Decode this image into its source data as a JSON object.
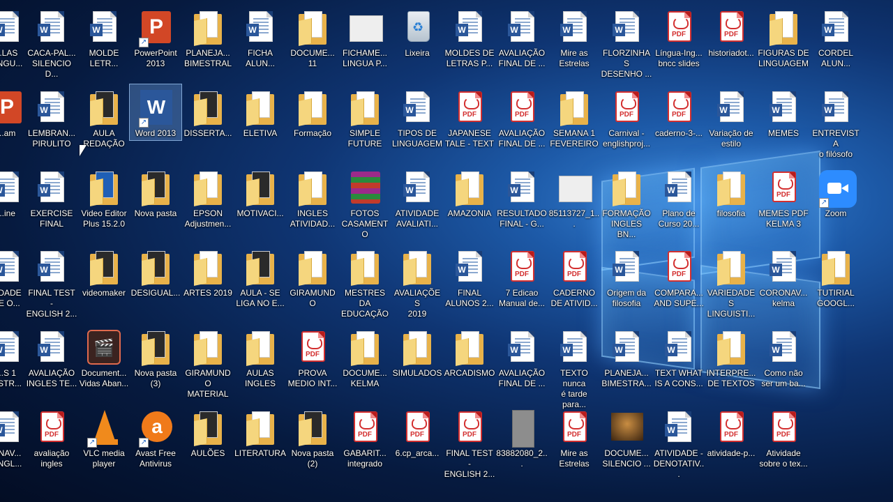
{
  "desktop": {
    "rows": [
      [
        {
          "label": "...LAS\nLINGU...",
          "type": "word"
        },
        {
          "label": "CACA-PAL...\nSILENCIO D...",
          "type": "word"
        },
        {
          "label": "MOLDE\nLETR...",
          "type": "word"
        },
        {
          "label": "PowerPoint\n2013",
          "type": "ppt"
        },
        {
          "label": "PLANEJA...\nBIMESTRAL",
          "type": "folder"
        },
        {
          "label": "FICHA\nALUN...",
          "type": "word"
        },
        {
          "label": "DOCUME...\n11",
          "type": "folder"
        },
        {
          "label": "FICHAME...\nLINGUA P...",
          "type": "thumb"
        },
        {
          "label": "Lixeira",
          "type": "recycle"
        },
        {
          "label": "MOLDES DE\nLETRAS P...",
          "type": "word"
        },
        {
          "label": "AVALIAÇÃO\nFINAL DE ...",
          "type": "word"
        },
        {
          "label": "Mire as\nEstrelas",
          "type": "word"
        },
        {
          "label": "FLORZINHAS\nDESENHO ...",
          "type": "word"
        },
        {
          "label": "Língua-Ing...\nbncc slides",
          "type": "pdf"
        },
        {
          "label": "historiadot...",
          "type": "pdf"
        },
        {
          "label": "FIGURAS DE\nLINGUAGEM",
          "type": "folder"
        },
        {
          "label": "CORDEL\nALUN...",
          "type": "word"
        }
      ],
      [
        {
          "label": "...am",
          "type": "ppt"
        },
        {
          "label": "LEMBRAN...\nPIRULITO",
          "type": "word"
        },
        {
          "label": "AULA\nREDAÇÃO",
          "type": "folder-dark"
        },
        {
          "label": "Word 2013",
          "type": "word2013",
          "selected": true
        },
        {
          "label": "DISSERTA...",
          "type": "folder-dark"
        },
        {
          "label": "ELETIVA",
          "type": "folder"
        },
        {
          "label": "Formação",
          "type": "folder"
        },
        {
          "label": "SIMPLE\nFUTURE",
          "type": "folder"
        },
        {
          "label": "TIPOS DE\nLINGUAGEM",
          "type": "word"
        },
        {
          "label": "JAPANESE\nTALE - TEXT",
          "type": "pdf"
        },
        {
          "label": "AVALIAÇÃO\nFINAL DE ...",
          "type": "pdf"
        },
        {
          "label": "SEMANA 1\nFEVEREIRO",
          "type": "folder"
        },
        {
          "label": "Carnival -\nenglishproj...",
          "type": "pdf"
        },
        {
          "label": "caderno-3-...",
          "type": "pdf"
        },
        {
          "label": "Variação de\nestilo",
          "type": "word"
        },
        {
          "label": "MEMES",
          "type": "word"
        },
        {
          "label": "ENTREVISTA\no filósofo",
          "type": "word"
        }
      ],
      [
        {
          "label": "...ine",
          "type": "word"
        },
        {
          "label": "EXERCISE\nFINAL",
          "type": "word"
        },
        {
          "label": "Video Editor\nPlus 15.2.0",
          "type": "folder-blue"
        },
        {
          "label": "Nova pasta",
          "type": "folder-dark"
        },
        {
          "label": "EPSON\nAdjustmen...",
          "type": "folder"
        },
        {
          "label": "MOTIVACI...",
          "type": "folder-dark"
        },
        {
          "label": "INGLES\nATIVIDAD...",
          "type": "folder"
        },
        {
          "label": "FOTOS\nCASAMENTO",
          "type": "winrar"
        },
        {
          "label": "ATIVIDADE\nAVALIATI...",
          "type": "word"
        },
        {
          "label": "AMAZONIA",
          "type": "folder"
        },
        {
          "label": "RESULTADO\nFINAL - G...",
          "type": "word"
        },
        {
          "label": "85113727_1...",
          "type": "thumb"
        },
        {
          "label": "FORMAÇÃO\nINGLES BN...",
          "type": "folder"
        },
        {
          "label": "Plano de\nCurso 20...",
          "type": "word"
        },
        {
          "label": "filosofia",
          "type": "folder"
        },
        {
          "label": "MEMES PDF\nKELMA 3",
          "type": "pdf"
        },
        {
          "label": "Zoom",
          "type": "zoom"
        }
      ],
      [
        {
          "label": "...DADE\nDE O...",
          "type": "word"
        },
        {
          "label": "FINAL TEST -\nENGLISH 2...",
          "type": "word"
        },
        {
          "label": "videomaker",
          "type": "folder-dark"
        },
        {
          "label": "DESIGUAL...",
          "type": "folder-dark"
        },
        {
          "label": "ARTES 2019",
          "type": "folder"
        },
        {
          "label": "AULA - SE\nLIGA NO E...",
          "type": "folder-dark"
        },
        {
          "label": "GIRAMUNDO",
          "type": "folder"
        },
        {
          "label": "MESTRES DA\nEDUCAÇÃO",
          "type": "folder"
        },
        {
          "label": "AVALIAÇÕES\n2019",
          "type": "folder"
        },
        {
          "label": "FINAL\nALUNOS 2...",
          "type": "word"
        },
        {
          "label": "7 Edicao\nManual de...",
          "type": "pdf"
        },
        {
          "label": "CADERNO\nDE ATIVID...",
          "type": "pdf"
        },
        {
          "label": "Origem da\nfilosofia",
          "type": "word"
        },
        {
          "label": "COMPARA...\nAND SUPE...",
          "type": "pdf"
        },
        {
          "label": "VARIEDADES\nLINGUISTI...",
          "type": "folder"
        },
        {
          "label": "CORONAV...\nkelma",
          "type": "word"
        },
        {
          "label": "TUTIRIAL\nGOOGL...",
          "type": "folder"
        }
      ],
      [
        {
          "label": "...S 1\n...STR...",
          "type": "word"
        },
        {
          "label": "AVALIAÇÃO\nINGLES TE...",
          "type": "word"
        },
        {
          "label": "Document...\nVidas Aban...",
          "type": "video"
        },
        {
          "label": "Nova pasta\n(3)",
          "type": "folder-dark"
        },
        {
          "label": "GIRAMUNDO\nMATERIAL",
          "type": "folder"
        },
        {
          "label": "AULAS\nINGLES",
          "type": "folder"
        },
        {
          "label": "PROVA\nMEDIO INT...",
          "type": "pdf"
        },
        {
          "label": "DOCUME...\nKELMA",
          "type": "folder"
        },
        {
          "label": "SIMULADOS",
          "type": "folder"
        },
        {
          "label": "ARCADISMO",
          "type": "folder"
        },
        {
          "label": "AVALIAÇÃO\nFINAL DE ...",
          "type": "word"
        },
        {
          "label": "TEXTO nunca\né tarde para...",
          "type": "word-old"
        },
        {
          "label": "PLANEJA...\nBIMESTRA...",
          "type": "word"
        },
        {
          "label": "TEXT WHAT\nIS A CONS...",
          "type": "word"
        },
        {
          "label": "INTERPRE...\nDE TEXTOS",
          "type": "folder"
        },
        {
          "label": "Como não\nser um ba...",
          "type": "word"
        }
      ],
      [
        {
          "label": "...NAV...\n...NGL...",
          "type": "word"
        },
        {
          "label": "avaliação\ningles",
          "type": "pdf"
        },
        {
          "label": "VLC media\nplayer",
          "type": "vlc"
        },
        {
          "label": "Avast Free\nAntivirus",
          "type": "avast"
        },
        {
          "label": "AULÕES",
          "type": "folder-dark"
        },
        {
          "label": "LITERATURA",
          "type": "folder"
        },
        {
          "label": "Nova pasta\n(2)",
          "type": "folder-dark"
        },
        {
          "label": "GABARIT...\nintegrado",
          "type": "pdf"
        },
        {
          "label": "6.cp_arca...",
          "type": "pdf"
        },
        {
          "label": "FINAL TEST -\nENGLISH 2...",
          "type": "pdf"
        },
        {
          "label": "83882080_2...",
          "type": "gray"
        },
        {
          "label": "Mire as\nEstrelas",
          "type": "pdf"
        },
        {
          "label": "DOCUME...\nSILENCIO ...",
          "type": "photo"
        },
        {
          "label": "ATIVIDADE -\nDENOTATIV...",
          "type": "word"
        },
        {
          "label": "atividade-p...",
          "type": "pdf"
        },
        {
          "label": "Atividade\nsobre o tex...",
          "type": "pdf"
        }
      ]
    ]
  },
  "glyphs": {
    "word": "W",
    "ppt": "P",
    "pdf": "PDF",
    "avast": "a",
    "video": "🎬",
    "recycle": "♻"
  },
  "colors": {
    "word": "#2b579a",
    "pdf": "#d32f2f",
    "folder": "#e8b24a",
    "zoom": "#2d8cff"
  }
}
